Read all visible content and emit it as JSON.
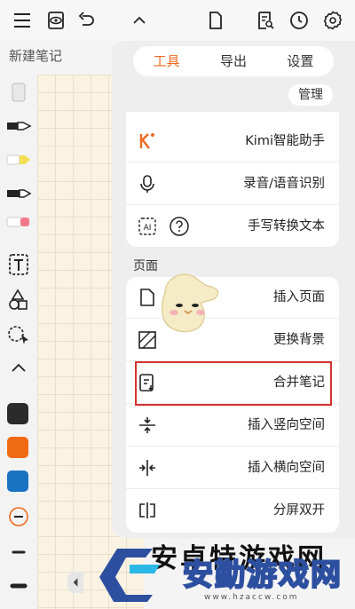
{
  "note": {
    "title": "新建笔记"
  },
  "tabs": [
    {
      "label": "工具"
    },
    {
      "label": "导出"
    },
    {
      "label": "设置"
    }
  ],
  "manage_label": "管理",
  "tools_group": [
    {
      "label": "Kimi智能助手",
      "icon": "kimi-icon"
    },
    {
      "label": "录音/语音识别",
      "icon": "microphone-ai-icon"
    },
    {
      "label": "手写转换文本",
      "icon": "ai-handwriting-icon",
      "secondary_icon": "help-icon"
    }
  ],
  "page_section": {
    "title": "页面",
    "items": [
      {
        "label": "插入页面",
        "icon": "insert-page-icon"
      },
      {
        "label": "更换背景",
        "icon": "background-icon"
      },
      {
        "label": "合并笔记",
        "icon": "merge-notes-icon"
      },
      {
        "label": "插入竖向空间",
        "icon": "vertical-space-icon"
      },
      {
        "label": "插入横向空间",
        "icon": "horizontal-space-icon"
      },
      {
        "label": "分屏双开",
        "icon": "split-screen-icon"
      }
    ]
  },
  "toolbar_icons": [
    "menu-icon",
    "view-icon",
    "undo-icon",
    "collapse-icon",
    "page-icon",
    "search-doc-icon",
    "history-icon",
    "settings-icon"
  ],
  "swatches": [
    "#2b2b2b",
    "#f06a13",
    "#1a73c2"
  ],
  "accent": "#ee6a1f",
  "highlight_color": "#d4322f",
  "watermark": {
    "text": "安勤游戏网",
    "url": "www.hzaccw.com"
  },
  "behind_text": "安卓特游戏网"
}
